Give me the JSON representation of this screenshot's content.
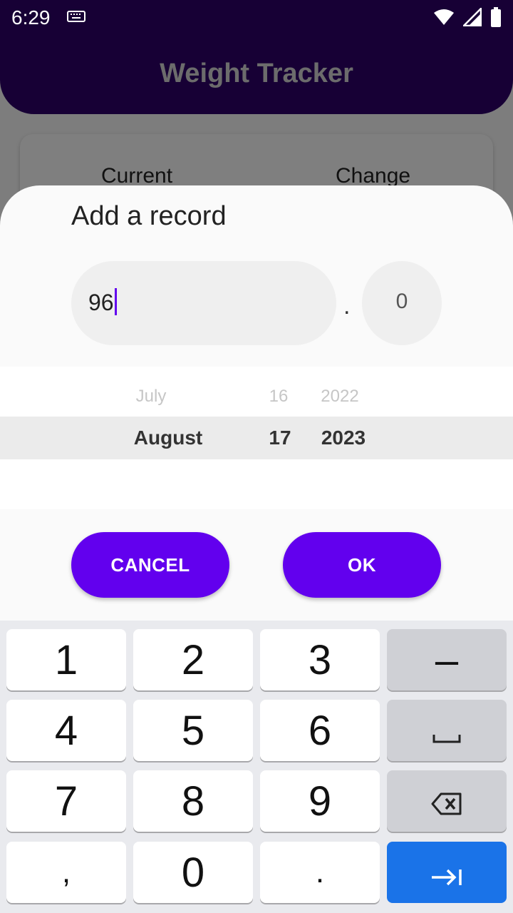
{
  "status_bar": {
    "time": "6:29"
  },
  "app": {
    "title": "Weight Tracker",
    "summary": {
      "current_label": "Current",
      "change_label": "Change"
    }
  },
  "dialog": {
    "title": "Add a record",
    "weight_integer": "96",
    "decimal_separator": ".",
    "weight_fraction_placeholder": "0",
    "date_picker": {
      "month": {
        "previous": "July",
        "selected": "August"
      },
      "day": {
        "previous": "16",
        "selected": "17"
      },
      "year": {
        "previous": "2022",
        "selected": "2023"
      }
    },
    "cancel_label": "CANCEL",
    "ok_label": "OK"
  },
  "keyboard": {
    "row1": [
      "1",
      "2",
      "3",
      "–"
    ],
    "row2": [
      "4",
      "5",
      "6"
    ],
    "row3": [
      "7",
      "8",
      "9"
    ],
    "row4": [
      ",",
      "0",
      "."
    ],
    "icons": {
      "space": "space-icon",
      "backspace": "backspace-icon",
      "enter": "tab-next-icon"
    }
  },
  "colors": {
    "accent": "#6200ee",
    "app_bar": "#2e006b",
    "enter_key": "#1a73e8"
  }
}
